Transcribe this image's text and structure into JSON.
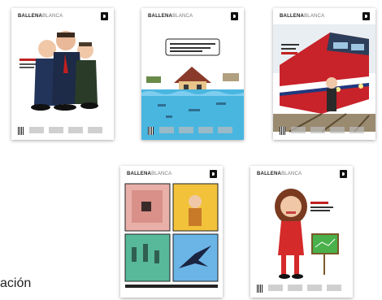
{
  "magazine": {
    "title_bold": "BALLENA",
    "title_light": "BLANCA"
  },
  "covers": [
    {
      "theme": "politicians-caricature"
    },
    {
      "theme": "flooded-house"
    },
    {
      "theme": "train"
    },
    {
      "theme": "comic-grid"
    },
    {
      "theme": "woman-caricature"
    }
  ],
  "caption": "ación"
}
